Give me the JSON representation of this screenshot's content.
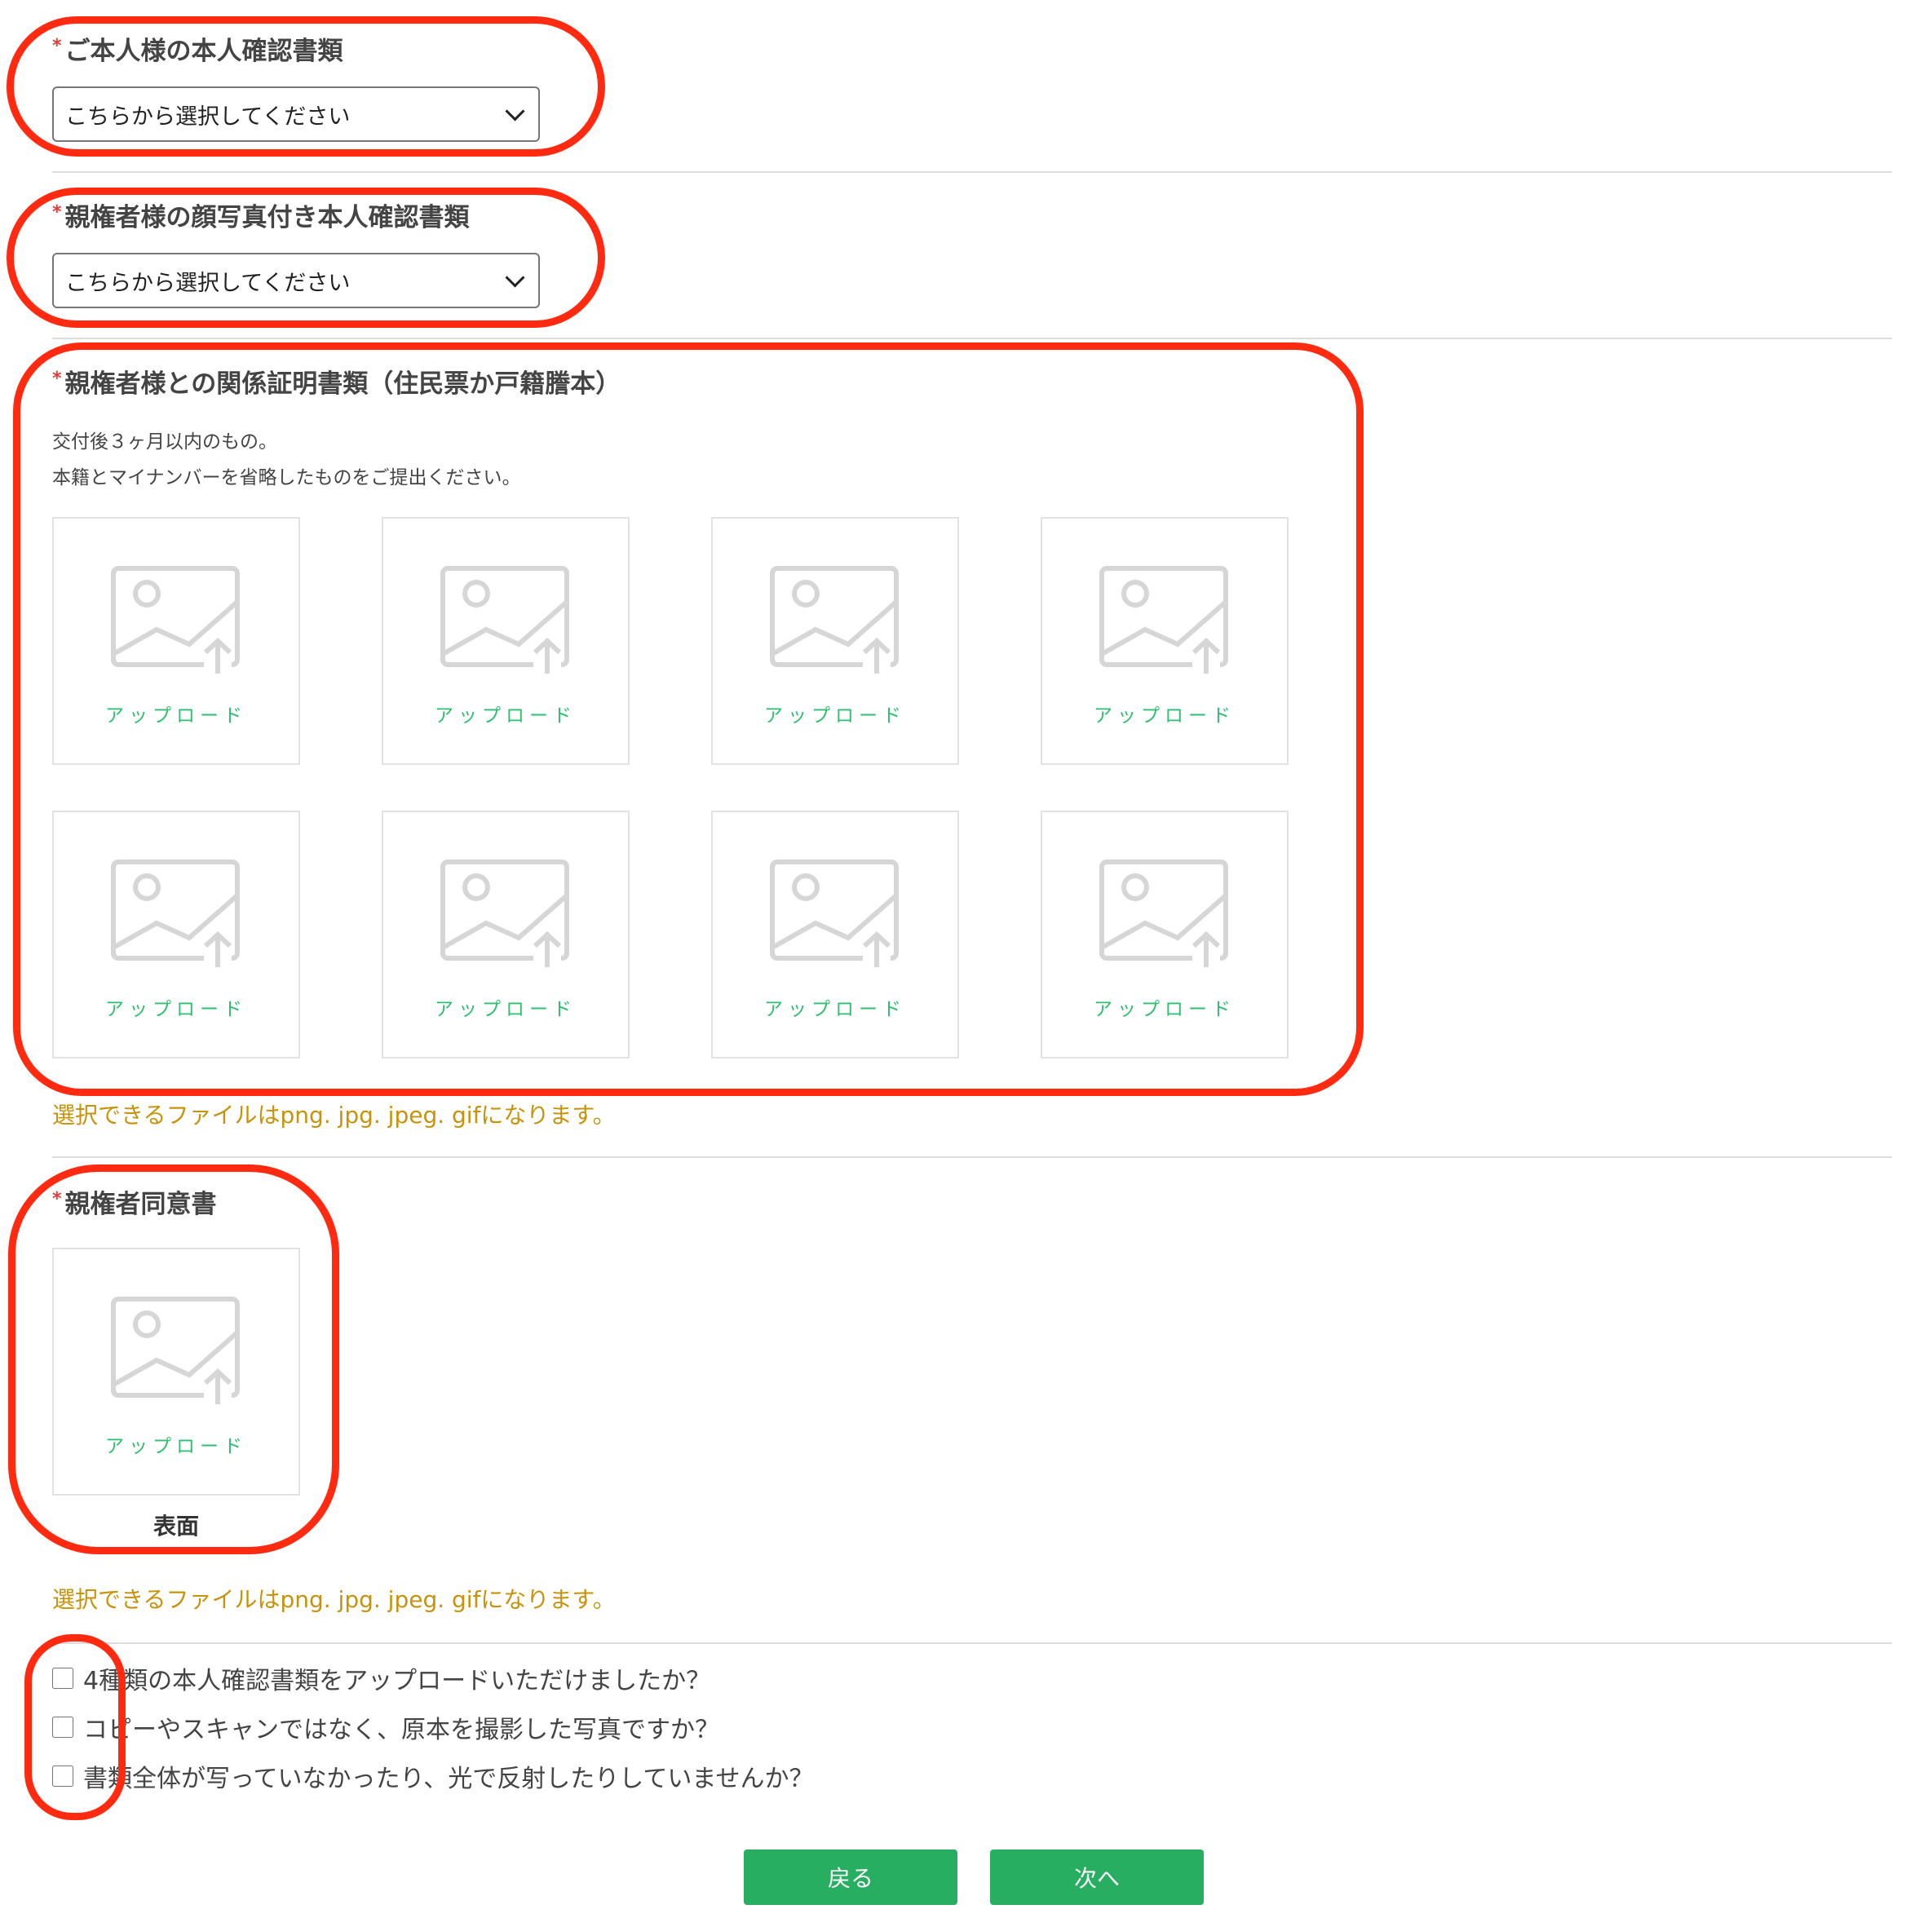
{
  "sections": {
    "applicant_id": {
      "required_mark": "*",
      "label": "ご本人様の本人確認書類",
      "select_value": "こちらから選択してください"
    },
    "guardian_photo_id": {
      "required_mark": "*",
      "label": "親権者様の顔写真付き本人確認書類",
      "select_value": "こちらから選択してください"
    },
    "relationship_proof": {
      "required_mark": "*",
      "label": "親権者様との関係証明書類（住民票か戸籍謄本）",
      "note_line1": "交付後３ヶ月以内のもの。",
      "note_line2": "本籍とマイナンバーを省略したものをご提出ください。",
      "upload_label": "アップロード",
      "file_hint": "選択できるファイルはpng. jpg. jpeg. gifになります。"
    },
    "guardian_consent": {
      "required_mark": "*",
      "label": "親権者同意書",
      "upload_label": "アップロード",
      "caption": "表面",
      "file_hint": "選択できるファイルはpng. jpg. jpeg. gifになります。"
    }
  },
  "checklist": [
    "4種類の本人確認書類をアップロードいただけましたか？",
    "コピーやスキャンではなく、原本を撮影した写真ですか？",
    "書類全体が写っていなかったり、光で反射したりしていませんか？"
  ],
  "buttons": {
    "back": "戻る",
    "next": "次へ"
  },
  "colors": {
    "accent_green": "#27ae60",
    "upload_text": "#2fbf71",
    "hint_text": "#c8930c",
    "required": "#e53935",
    "annotation_ring": "#ff2a10"
  }
}
